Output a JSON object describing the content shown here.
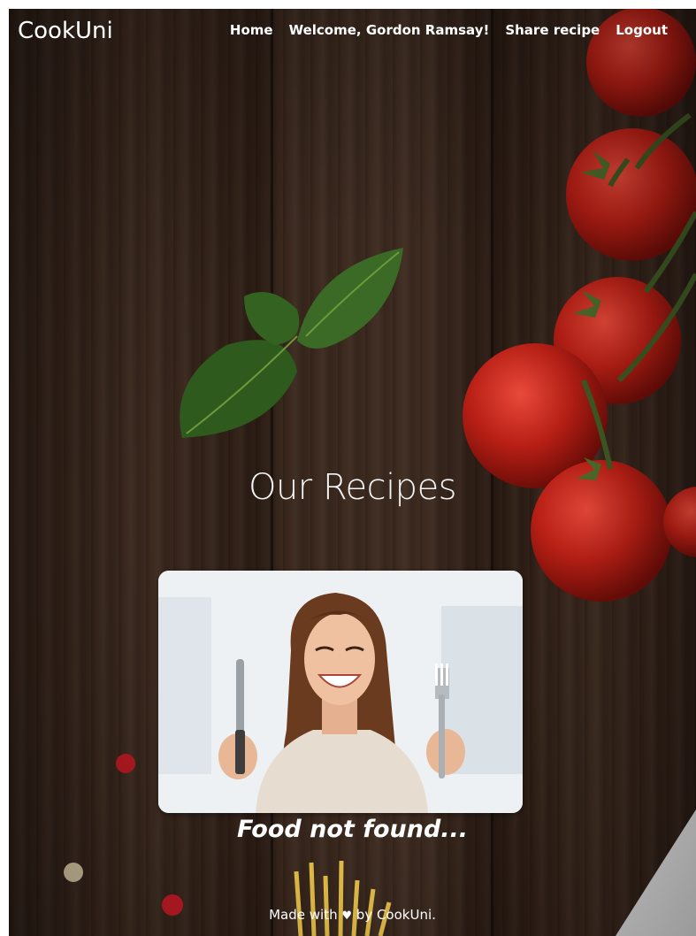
{
  "navbar": {
    "brand": "CookUni",
    "links": [
      {
        "label": "Home"
      },
      {
        "label": "Welcome, Gordon Ramsay!"
      },
      {
        "label": "Share recipe"
      },
      {
        "label": "Logout"
      }
    ]
  },
  "main": {
    "title": "Our Recipes",
    "empty_state": {
      "caption": "Food not found..."
    }
  },
  "footer": {
    "prefix": "Made with",
    "heart_icon": "heart-icon",
    "suffix": "by CookUni."
  },
  "colors": {
    "text": "#ffffff",
    "wood_dark": "#2e1f17",
    "tomato": "#c4261b",
    "basil": "#2f5a1e"
  }
}
